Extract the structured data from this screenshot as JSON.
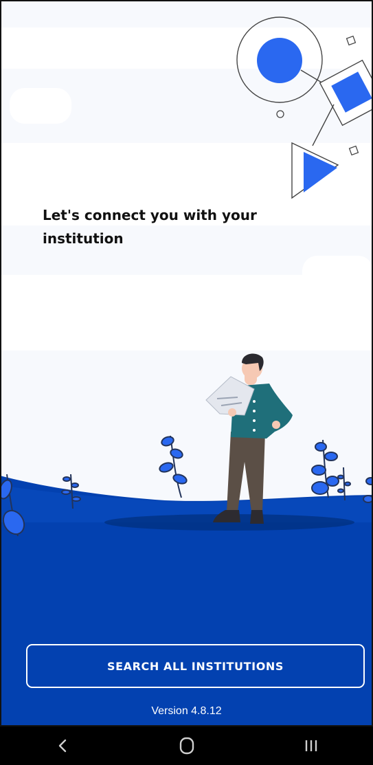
{
  "intro": {
    "headline": "Let's connect you with your institution"
  },
  "actions": {
    "search_label": "SEARCH ALL INSTITUTIONS"
  },
  "footer": {
    "version": "Version 4.8.12"
  },
  "navigation": {
    "back": "back-icon",
    "home": "home-icon",
    "recents": "recents-icon"
  },
  "colors": {
    "primary_blue": "#0341b0",
    "accent_blue": "#2a68f0",
    "background": "#f7f9fd",
    "button_text": "#ffffff"
  }
}
